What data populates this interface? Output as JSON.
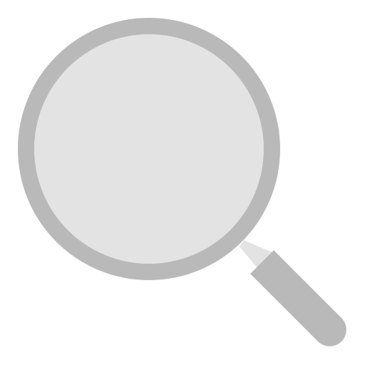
{
  "icon": {
    "name": "search-icon",
    "colors": {
      "rim": "#b9b9b9",
      "lens": "#e3e3e3",
      "neck": "#e3e3e3",
      "handle": "#b9b9b9",
      "background": "#ffffff"
    }
  }
}
